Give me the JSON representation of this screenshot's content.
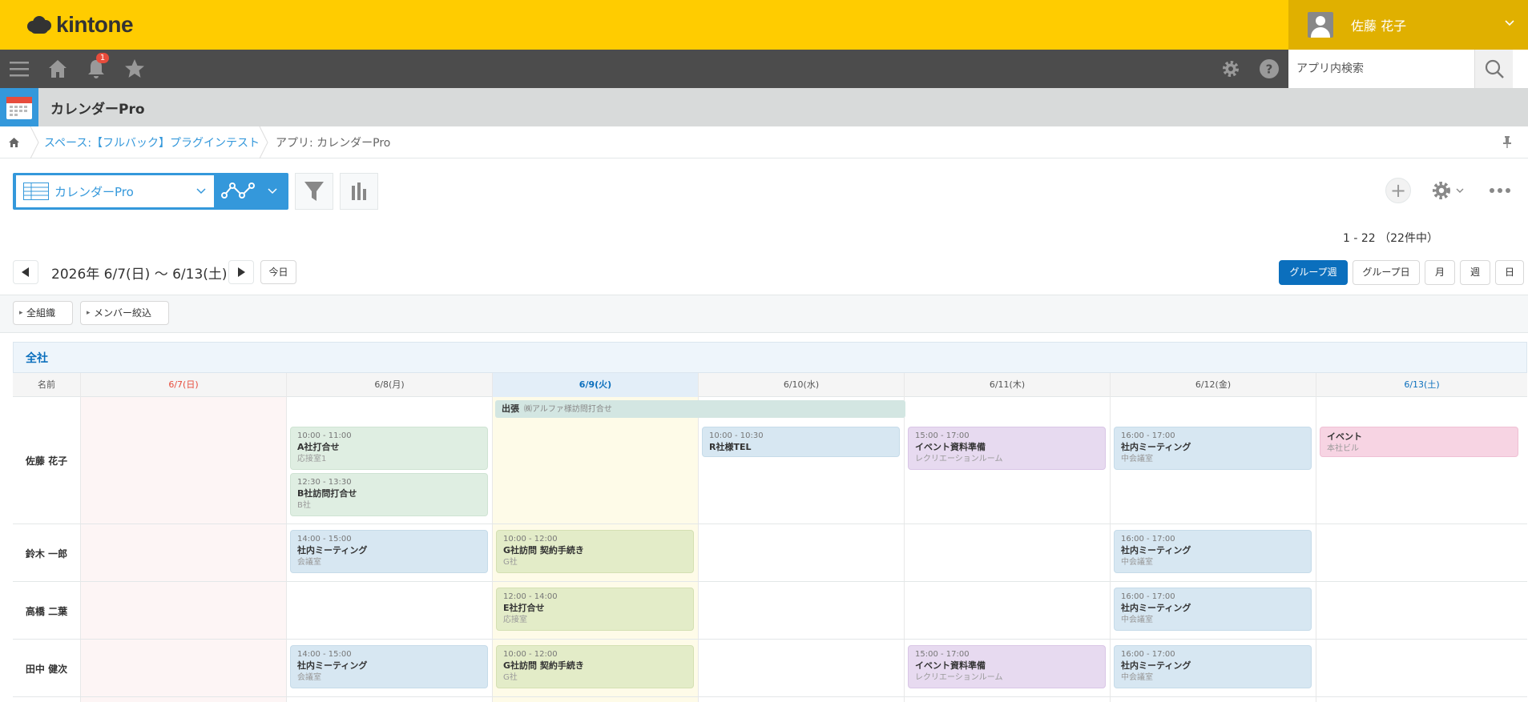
{
  "header": {
    "logo_text": "kintone",
    "user_name": "佐藤 花子",
    "notification_count": "1",
    "search_placeholder": "アプリ内検索"
  },
  "app": {
    "title": "カレンダーPro"
  },
  "breadcrumb": {
    "space": "スペース:【フルバック】プラグインテスト",
    "app": "アプリ: カレンダーPro"
  },
  "toolbar": {
    "view_name": "カレンダーPro",
    "record_count": "1 - 22 （22件中）"
  },
  "calendar": {
    "date_range": "2026年 6/7(日) 〜 6/13(土)",
    "today_label": "今日",
    "view_buttons": [
      "グループ週",
      "グループ日",
      "月",
      "週",
      "日"
    ],
    "filters": [
      "全組織",
      "メンバー絞込"
    ],
    "group_name": "全社",
    "name_header": "名前",
    "days": [
      "6/7(日)",
      "6/8(月)",
      "6/9(火)",
      "6/10(水)",
      "6/11(木)",
      "6/12(金)",
      "6/13(土)"
    ],
    "members": [
      "佐藤 花子",
      "鈴木 一郎",
      "高橋 二葉",
      "田中 健次"
    ],
    "banner": {
      "title": "出張",
      "detail": "㈱アルファ様訪問打合せ"
    },
    "events": [
      {
        "time": "10:00 - 11:00",
        "name": "A社打合せ",
        "place": "応接室1"
      },
      {
        "time": "12:30 - 13:30",
        "name": "B社訪問打合せ",
        "place": "B社"
      },
      {
        "time": "10:00 - 10:30",
        "name": "R社様TEL",
        "place": ""
      },
      {
        "time": "15:00 - 17:00",
        "name": "イベント資料準備",
        "place": "レクリエーションルーム"
      },
      {
        "time": "16:00 - 17:00",
        "name": "社内ミーティング",
        "place": "中会議室"
      },
      {
        "time": "",
        "name": "イベント",
        "place": "本社ビル"
      },
      {
        "time": "14:00 - 15:00",
        "name": "社内ミーティング",
        "place": "会議室"
      },
      {
        "time": "10:00 - 12:00",
        "name": "G社訪問 契約手続き",
        "place": "G社"
      },
      {
        "time": "16:00 - 17:00",
        "name": "社内ミーティング",
        "place": "中会議室"
      },
      {
        "time": "12:00 - 14:00",
        "name": "E社打合せ",
        "place": "応接室"
      },
      {
        "time": "16:00 - 17:00",
        "name": "社内ミーティング",
        "place": "中会議室"
      },
      {
        "time": "14:00 - 15:00",
        "name": "社内ミーティング",
        "place": "会議室"
      },
      {
        "time": "10:00 - 12:00",
        "name": "G社訪問 契約手続き",
        "place": "G社"
      },
      {
        "time": "15:00 - 17:00",
        "name": "イベント資料準備",
        "place": "レクリエーションルーム"
      },
      {
        "time": "16:00 - 17:00",
        "name": "社内ミーティング",
        "place": "中会議室"
      }
    ]
  },
  "colors": {
    "header_yellow": "#ffcc00",
    "accent_blue": "#3498db",
    "sunday_red": "#e74c3c",
    "saturday_blue": "#0b6fbd"
  }
}
